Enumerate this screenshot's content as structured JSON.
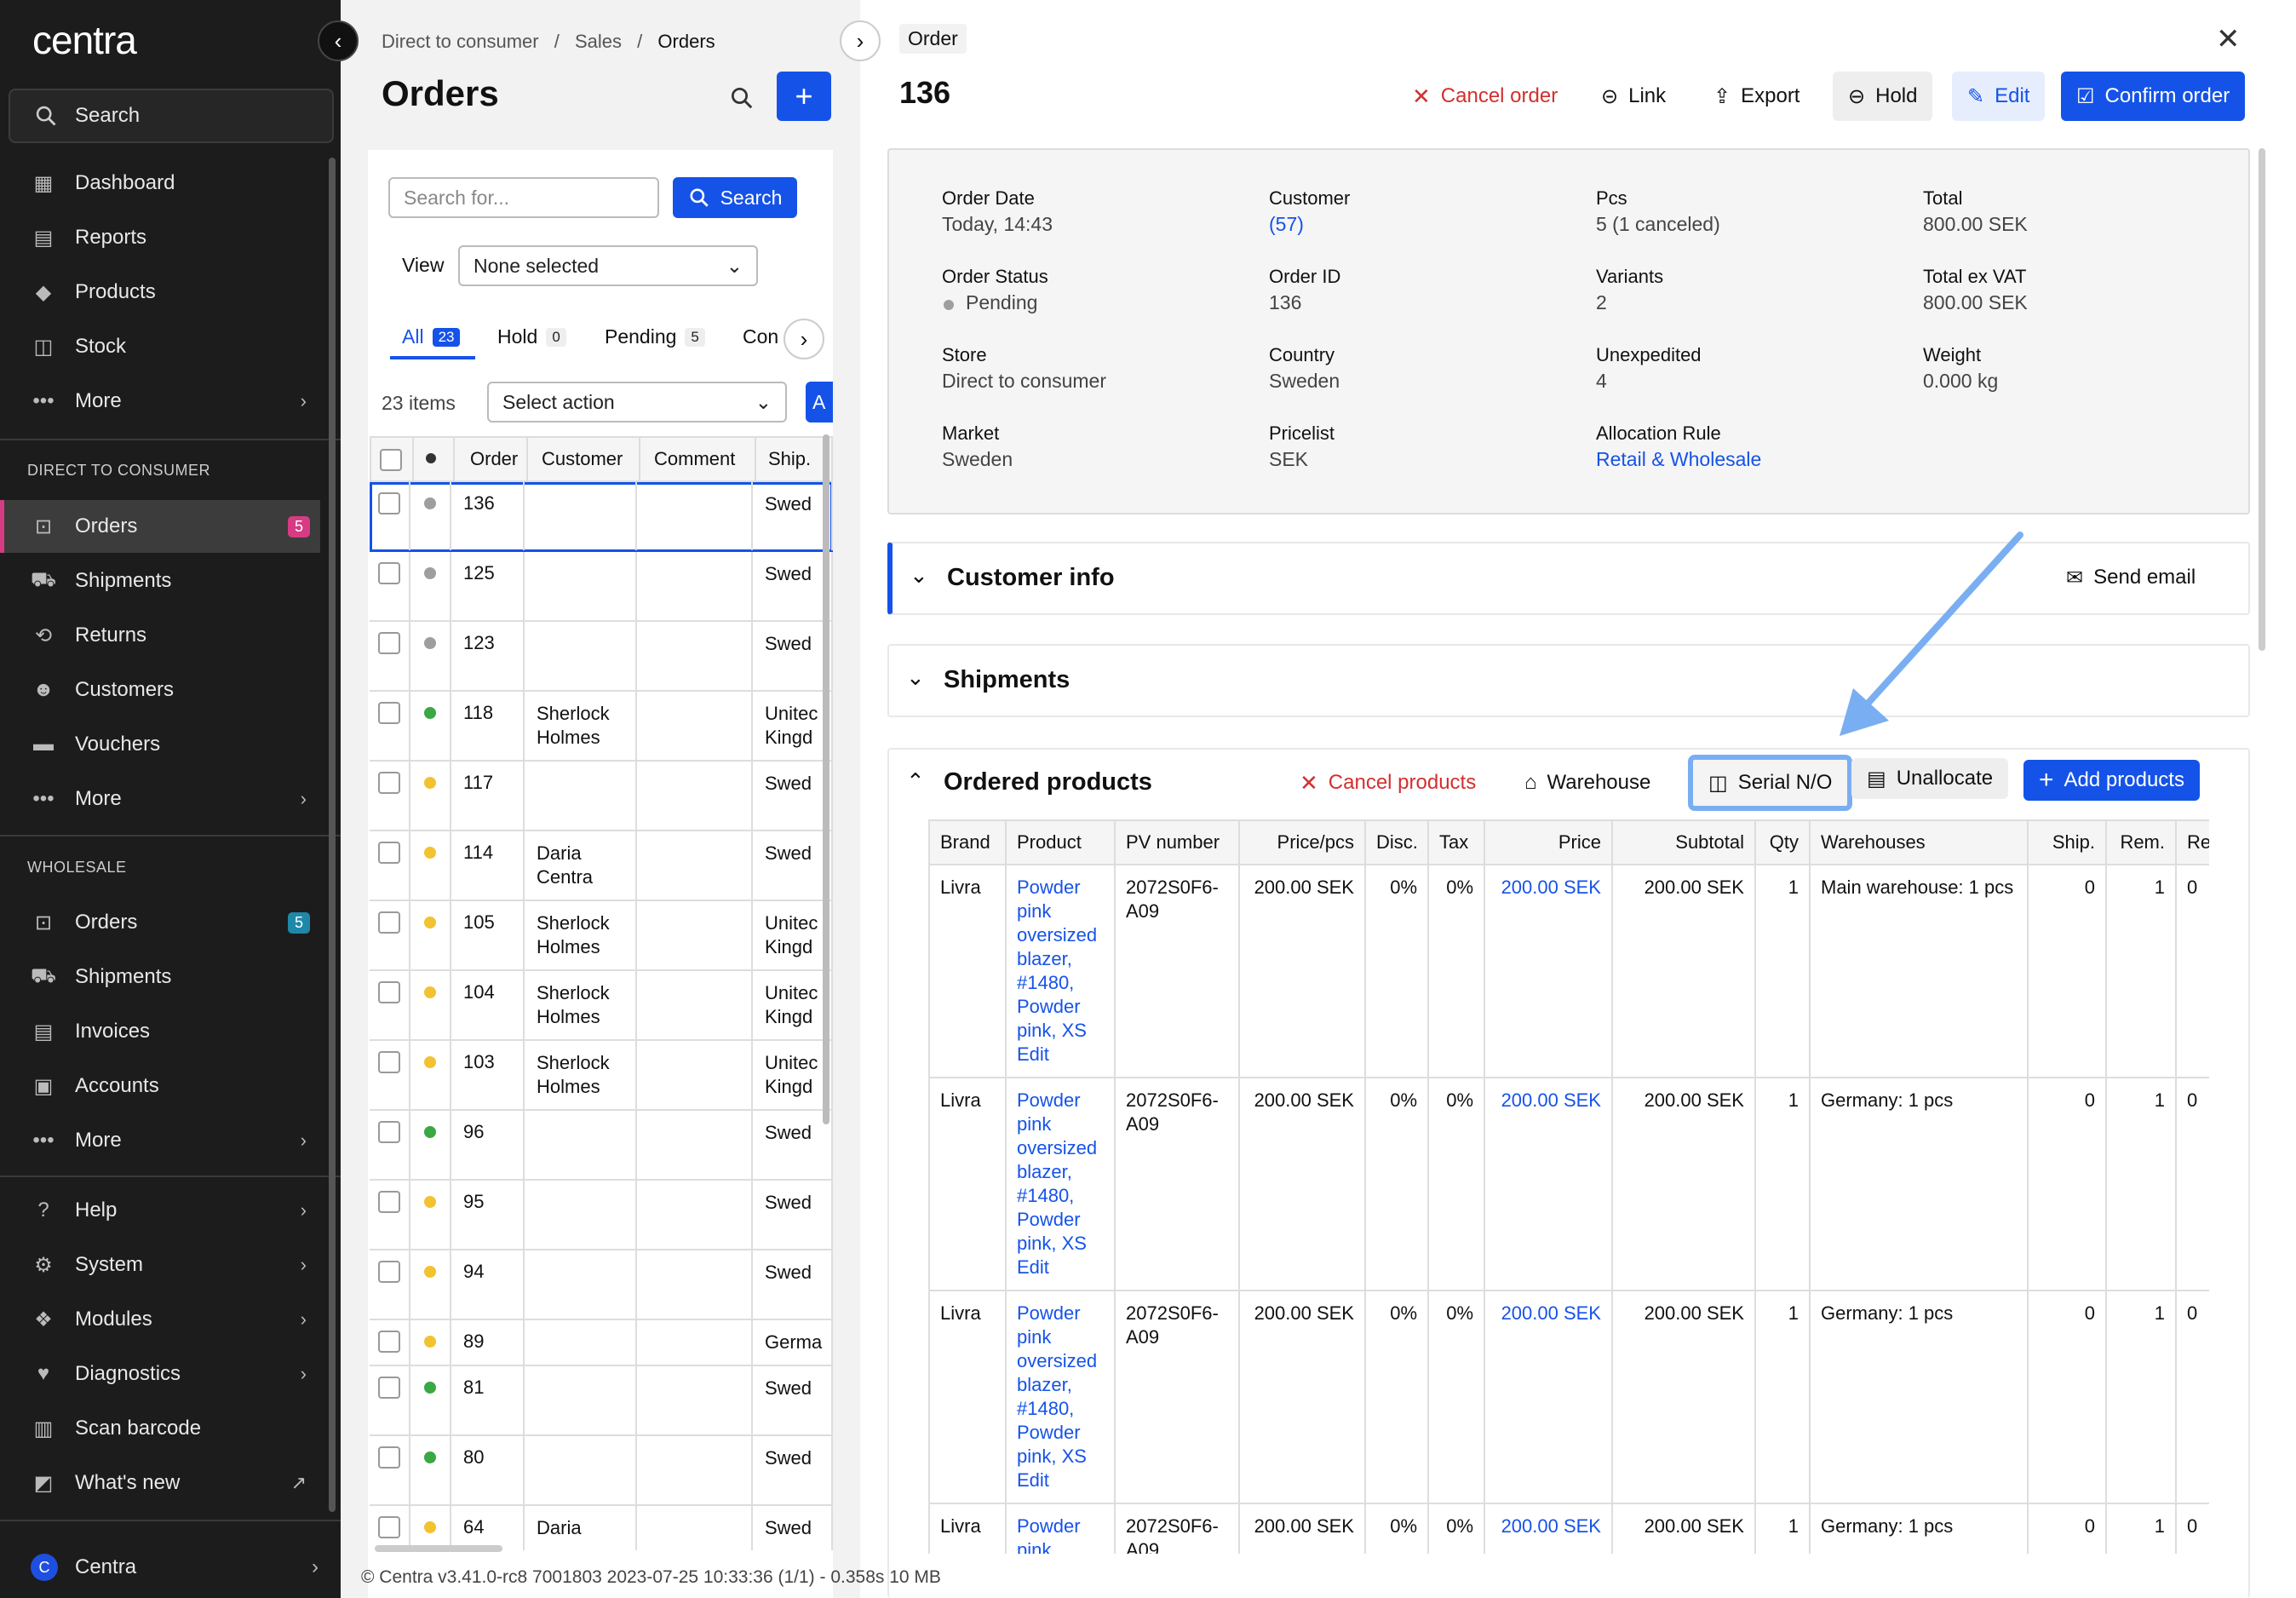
{
  "sidebar": {
    "logo": "centra",
    "search_label": "Search",
    "top_items": [
      {
        "label": "Dashboard",
        "icon": "dashboard-icon"
      },
      {
        "label": "Reports",
        "icon": "reports-icon"
      },
      {
        "label": "Products",
        "icon": "tag-icon"
      },
      {
        "label": "Stock",
        "icon": "stock-icon"
      },
      {
        "label": "More",
        "icon": "more-icon"
      }
    ],
    "section_dtc": "DIRECT TO CONSUMER",
    "dtc_items": [
      {
        "label": "Orders",
        "badge": "5"
      },
      {
        "label": "Shipments"
      },
      {
        "label": "Returns"
      },
      {
        "label": "Customers"
      },
      {
        "label": "Vouchers"
      },
      {
        "label": "More"
      }
    ],
    "section_wholesale": "WHOLESALE",
    "wholesale_items": [
      {
        "label": "Orders",
        "badge": "5"
      },
      {
        "label": "Shipments"
      },
      {
        "label": "Invoices"
      },
      {
        "label": "Accounts"
      },
      {
        "label": "More"
      }
    ],
    "bottom_items": [
      {
        "label": "Help"
      },
      {
        "label": "System"
      },
      {
        "label": "Modules"
      },
      {
        "label": "Diagnostics"
      },
      {
        "label": "Scan barcode"
      },
      {
        "label": "What's new"
      }
    ],
    "footer_label": "Centra",
    "footer_logo": "C"
  },
  "list": {
    "breadcrumb": [
      "Direct to consumer",
      "Sales",
      "Orders"
    ],
    "title": "Orders",
    "search_placeholder": "Search for...",
    "search_button": "Search",
    "view_label": "View",
    "view_value": "None selected",
    "tabs": [
      {
        "label": "All",
        "count": "23"
      },
      {
        "label": "Hold",
        "count": "0"
      },
      {
        "label": "Pending",
        "count": "5"
      },
      {
        "label": "Con"
      }
    ],
    "items_count": "23 items",
    "action_placeholder": "Select action",
    "apply_button": "A",
    "columns": [
      "Order",
      "Customer",
      "Comment",
      "Ship."
    ],
    "rows": [
      {
        "order": "136",
        "customer": "",
        "ship": "Swed",
        "status": "#9e9e9e"
      },
      {
        "order": "125",
        "customer": "",
        "ship": "Swed",
        "status": "#9e9e9e"
      },
      {
        "order": "123",
        "customer": "",
        "ship": "Swed",
        "status": "#9e9e9e"
      },
      {
        "order": "118",
        "customer": "Sherlock\nHolmes",
        "ship": "Unitec\nKingd",
        "status": "#3aa843"
      },
      {
        "order": "117",
        "customer": "",
        "ship": "Swed",
        "status": "#f2c230"
      },
      {
        "order": "114",
        "customer": "Daria\nCentra",
        "ship": "Swed",
        "status": "#f2c230"
      },
      {
        "order": "105",
        "customer": "Sherlock\nHolmes",
        "ship": "Unitec\nKingd",
        "status": "#f2c230"
      },
      {
        "order": "104",
        "customer": "Sherlock\nHolmes",
        "ship": "Unitec\nKingd",
        "status": "#f2c230"
      },
      {
        "order": "103",
        "customer": "Sherlock\nHolmes",
        "ship": "Unitec\nKingd",
        "status": "#f2c230"
      },
      {
        "order": "96",
        "customer": "",
        "ship": "Swed",
        "status": "#3aa843"
      },
      {
        "order": "95",
        "customer": "",
        "ship": "Swed",
        "status": "#f2c230"
      },
      {
        "order": "94",
        "customer": "",
        "ship": "Swed",
        "status": "#f2c230"
      },
      {
        "order": "89",
        "customer": "",
        "ship": "Germa",
        "status": "#f2c230"
      },
      {
        "order": "81",
        "customer": "",
        "ship": "Swed",
        "status": "#3aa843"
      },
      {
        "order": "80",
        "customer": "",
        "ship": "Swed",
        "status": "#3aa843"
      },
      {
        "order": "64",
        "customer": "Daria",
        "ship": "Swed",
        "status": "#f2c230"
      }
    ]
  },
  "order": {
    "header_label": "Order",
    "number": "136",
    "actions": {
      "cancel": "Cancel order",
      "link": "Link",
      "export": "Export",
      "hold": "Hold",
      "edit": "Edit",
      "confirm": "Confirm order"
    },
    "info": [
      {
        "label": "Order Date",
        "value": "Today, 14:43"
      },
      {
        "label": "Customer",
        "value": "(57)"
      },
      {
        "label": "Pcs",
        "value": "5 (1 canceled)"
      },
      {
        "label": "Total",
        "value": "800.00 SEK"
      },
      {
        "label": "Order Status",
        "value": "Pending"
      },
      {
        "label": "Order ID",
        "value": "136"
      },
      {
        "label": "Variants",
        "value": "2"
      },
      {
        "label": "Total ex VAT",
        "value": "800.00 SEK"
      },
      {
        "label": "Store",
        "value": "Direct to consumer"
      },
      {
        "label": "Country",
        "value": "Sweden"
      },
      {
        "label": "Unexpedited",
        "value": "4"
      },
      {
        "label": "Weight",
        "value": "0.000 kg"
      },
      {
        "label": "Market",
        "value": "Sweden"
      },
      {
        "label": "Pricelist",
        "value": "SEK"
      },
      {
        "label": "Allocation Rule",
        "value": "Retail & Wholesale"
      }
    ],
    "customer_info_title": "Customer info",
    "send_email": "Send email",
    "shipments_title": "Shipments",
    "ordered_title": "Ordered products",
    "product_actions": {
      "cancel": "Cancel products",
      "warehouse": "Warehouse",
      "serial": "Serial N/O",
      "unallocate": "Unallocate",
      "add": "Add products"
    },
    "product_columns": [
      "Brand",
      "Product",
      "PV number",
      "Price/pcs",
      "Disc.",
      "Tax",
      "Price",
      "Subtotal",
      "Qty",
      "Warehouses",
      "Ship.",
      "Rem.",
      "Ret"
    ],
    "products": [
      {
        "brand": "Livra",
        "product": "Powder pink oversized blazer, #1480, Powder pink, XS",
        "edit": "Edit",
        "pv": "2072S0F6-A09",
        "price_pcs": "200.00 SEK",
        "disc": "0%",
        "tax": "0%",
        "price": "200.00 SEK",
        "subtotal": "200.00 SEK",
        "qty": "1",
        "warehouses": "Main warehouse: 1 pcs",
        "ship": "0",
        "rem": "1",
        "ret": "0"
      },
      {
        "brand": "Livra",
        "product": "Powder pink oversized blazer, #1480, Powder pink, XS",
        "edit": "Edit",
        "pv": "2072S0F6-A09",
        "price_pcs": "200.00 SEK",
        "disc": "0%",
        "tax": "0%",
        "price": "200.00 SEK",
        "subtotal": "200.00 SEK",
        "qty": "1",
        "warehouses": "Germany: 1 pcs",
        "ship": "0",
        "rem": "1",
        "ret": "0"
      },
      {
        "brand": "Livra",
        "product": "Powder pink oversized blazer, #1480, Powder pink, XS",
        "edit": "Edit",
        "pv": "2072S0F6-A09",
        "price_pcs": "200.00 SEK",
        "disc": "0%",
        "tax": "0%",
        "price": "200.00 SEK",
        "subtotal": "200.00 SEK",
        "qty": "1",
        "warehouses": "Germany: 1 pcs",
        "ship": "0",
        "rem": "1",
        "ret": "0"
      },
      {
        "brand": "Livra",
        "product": "Powder pink",
        "edit": "",
        "pv": "2072S0F6-A09",
        "price_pcs": "200.00 SEK",
        "disc": "0%",
        "tax": "0%",
        "price": "200.00 SEK",
        "subtotal": "200.00 SEK",
        "qty": "1",
        "warehouses": "Germany: 1 pcs",
        "ship": "0",
        "rem": "1",
        "ret": "0"
      }
    ]
  },
  "footer": "© Centra v3.41.0-rc8 7001803 2023-07-25 10:33:36 (1/1) - 0.358s 10 MB",
  "colors": {
    "accent": "#1553e8",
    "badge": "#d63b83",
    "danger": "#d32f2f",
    "highlight": "#7aaef2"
  }
}
